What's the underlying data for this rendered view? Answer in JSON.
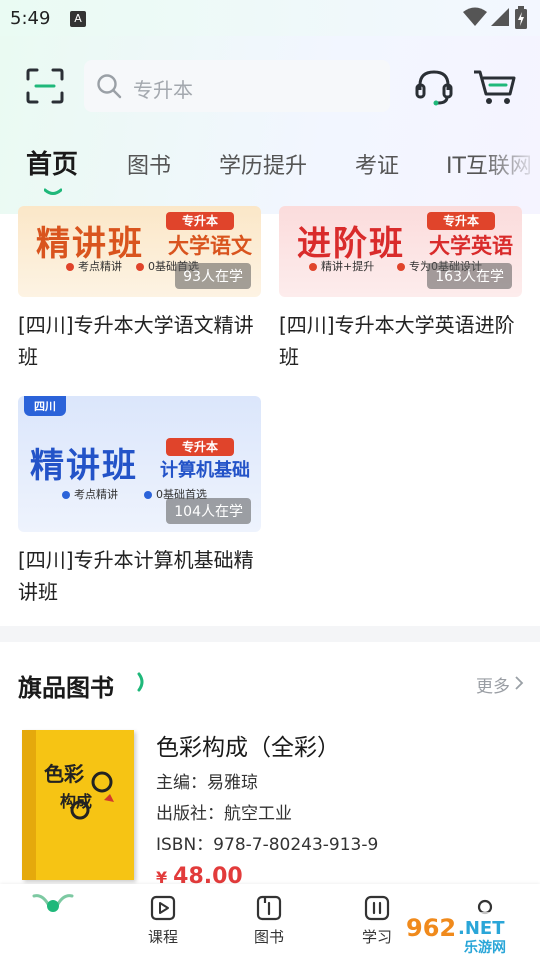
{
  "status_bar": {
    "time": "5:49",
    "notification_icon": "A"
  },
  "search": {
    "placeholder": "专升本"
  },
  "tabs": [
    {
      "label": "首页",
      "active": true
    },
    {
      "label": "图书",
      "active": false
    },
    {
      "label": "学历提升",
      "active": false
    },
    {
      "label": "考证",
      "active": false
    },
    {
      "label": "IT互联网",
      "active": false
    }
  ],
  "courses": [
    {
      "banner_big": "精讲班",
      "banner_tag": "专升本",
      "banner_subject": "大学语文",
      "features": [
        "考点精讲",
        "0基础首选"
      ],
      "learners": "93人在学",
      "title": "[四川]专升本大学语文精讲班"
    },
    {
      "banner_big": "进阶班",
      "banner_tag": "专升本",
      "banner_subject": "大学英语",
      "features": [
        "精讲+提升",
        "专为0基础设计"
      ],
      "learners": "163人在学",
      "title": "[四川]专升本大学英语进阶班"
    },
    {
      "region": "四川",
      "banner_big": "精讲班",
      "banner_tag": "专升本",
      "banner_subject": "计算机基础",
      "features": [
        "考点精讲",
        "0基础首选"
      ],
      "learners": "104人在学",
      "title": "[四川]专升本计算机基础精讲班"
    }
  ],
  "books_section": {
    "title": "旗品图书",
    "more": "更多"
  },
  "book": {
    "title": "色彩构成（全彩）",
    "editor": "主编：易雅琼",
    "publisher": "出版社：航空工业",
    "isbn": "ISBN：978-7-80243-913-9",
    "price_symbol": "¥",
    "price": "48.00",
    "cover_title_1": "色彩",
    "cover_title_2": "构成"
  },
  "bottom_nav": [
    {
      "label": "课程",
      "icon": "play-icon"
    },
    {
      "label": "图书",
      "icon": "book-icon"
    },
    {
      "label": "学习",
      "icon": "study-icon"
    }
  ],
  "watermark": {
    "text_1": "962",
    "text_2": ".NET",
    "text_3": "乐游网"
  },
  "colors": {
    "accent_green": "#1fb87a",
    "price_red": "#e23b3b",
    "region_blue": "#2b63d9"
  }
}
